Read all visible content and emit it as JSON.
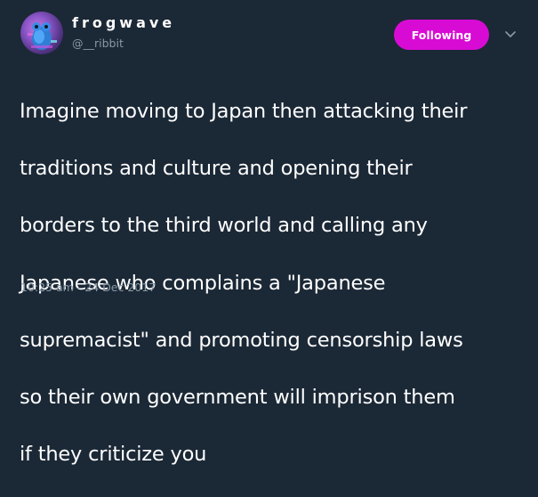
{
  "user": {
    "display_name": "frogwave",
    "handle": "@__ribbit",
    "avatar_icon": "frog-avatar-icon"
  },
  "actions": {
    "follow_label": "Following",
    "follow_color": "#d80bd4",
    "menu_icon": "chevron-down-icon"
  },
  "tweet": {
    "lines": [
      "Imagine moving to Japan then attacking their",
      "traditions and culture and opening their",
      "borders to the third world and calling any",
      "Japanese who complains a \"Japanese",
      "supremacist\" and promoting censorship laws",
      "so their own government will imprison them",
      "if they criticize you"
    ],
    "timestamp": "10:25 am - 24 Dec 2017"
  },
  "colors": {
    "background": "#1b2836",
    "text": "#ffffff",
    "muted": "#8899a6"
  }
}
